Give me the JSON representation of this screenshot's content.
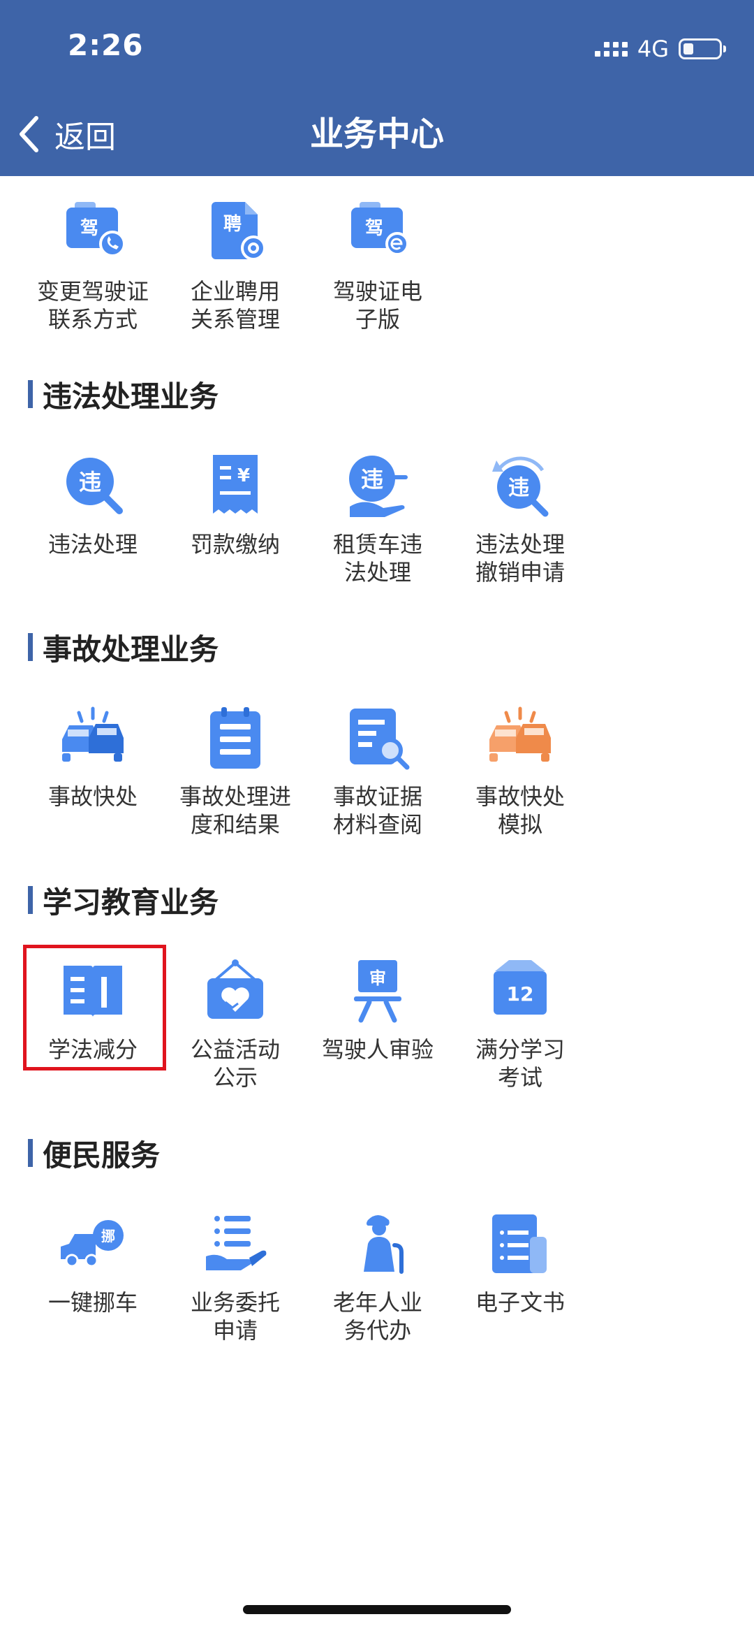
{
  "status_bar": {
    "time": "2:26",
    "network": "4G"
  },
  "header": {
    "back_label": "返回",
    "title": "业务中心"
  },
  "colors": {
    "header": "#3e64a8",
    "icon_blue": "#4a8af0",
    "icon_orange": "#ef8a4a",
    "highlight": "#e0141e"
  },
  "top_services": [
    {
      "label": "变更驾驶证\n联系方式",
      "icon": "license-phone-icon",
      "badge": "驾"
    },
    {
      "label": "企业聘用\n关系管理",
      "icon": "document-gear-icon",
      "badge": "聘"
    },
    {
      "label": "驾驶证电\n子版",
      "icon": "license-electronic-icon",
      "badge": "驾"
    }
  ],
  "sections": [
    {
      "title": "违法处理业务",
      "items": [
        {
          "label": "违法处理",
          "icon": "violation-search-icon",
          "badge": "违"
        },
        {
          "label": "罚款缴纳",
          "icon": "fine-receipt-icon",
          "badge": "¥"
        },
        {
          "label": "租赁车违\n法处理",
          "icon": "rental-violation-icon",
          "badge": "违"
        },
        {
          "label": "违法处理\n撤销申请",
          "icon": "violation-revoke-icon",
          "badge": "违"
        }
      ]
    },
    {
      "title": "事故处理业务",
      "items": [
        {
          "label": "事故快处",
          "icon": "car-accident-icon"
        },
        {
          "label": "事故处理进\n度和结果",
          "icon": "clipboard-progress-icon"
        },
        {
          "label": "事故证据\n材料查阅",
          "icon": "evidence-search-icon"
        },
        {
          "label": "事故快处\n模拟",
          "icon": "car-accident-simulation-icon"
        }
      ]
    },
    {
      "title": "学习教育业务",
      "items": [
        {
          "label": "学法减分",
          "icon": "open-book-icon",
          "highlighted": true
        },
        {
          "label": "公益活动\n公示",
          "icon": "charity-heart-icon"
        },
        {
          "label": "驾驶人审验",
          "icon": "review-board-icon",
          "badge": "审"
        },
        {
          "label": "满分学习\n考试",
          "icon": "exam-card-icon",
          "badge": "12"
        }
      ]
    },
    {
      "title": "便民服务",
      "items": [
        {
          "label": "一键挪车",
          "icon": "move-car-icon",
          "badge": "挪"
        },
        {
          "label": "业务委托\n申请",
          "icon": "delegation-hand-icon"
        },
        {
          "label": "老年人业\n务代办",
          "icon": "elderly-person-icon"
        },
        {
          "label": "电子文书",
          "icon": "e-document-icon"
        }
      ]
    }
  ]
}
